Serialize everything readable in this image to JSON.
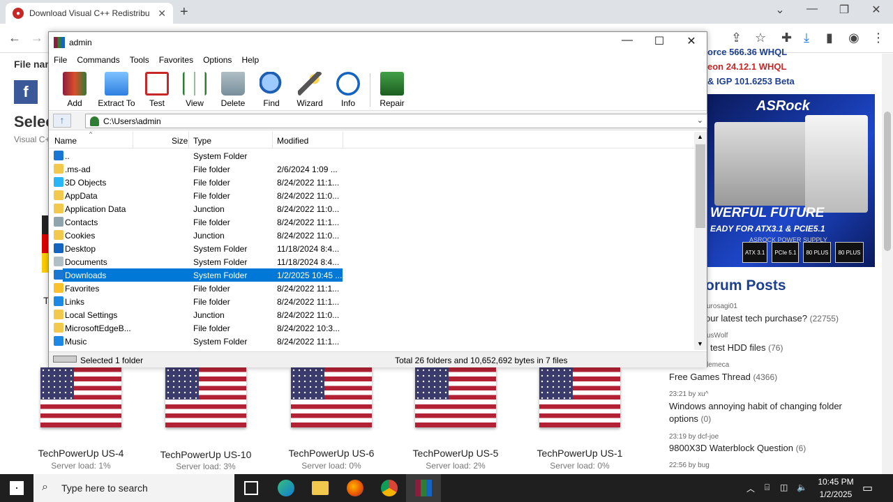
{
  "browser": {
    "tab_title": "Download Visual C++ Redistribu",
    "tab_close": "✕",
    "new_tab": "+"
  },
  "web": {
    "file_name_label": "File nam",
    "select_heading": "Selec",
    "sub_label": "Visual C+",
    "t_letter": "T",
    "driver_lines": [
      "orce 566.36 WHQL",
      "eon 24.12.1 WHQL",
      "& IGP 101.6253 Beta"
    ],
    "ad": {
      "brand": "ASRock",
      "line1": "WERFUL FUTURE",
      "line2": "EADY FOR ATX3.1 & PCIE5.1",
      "line3": "ASROCK POWER SUPPLY",
      "badges": [
        "ATX 3.1",
        "PCIe 5.1",
        "80 PLUS",
        "80 PLUS"
      ]
    },
    "forum_title": "orum Posts",
    "posts": [
      {
        "meta": "urosagi01",
        "title": "our latest tech purchase?",
        "count": "(22755)"
      },
      {
        "meta": "usWolf",
        "title": "test HDD files",
        "count": "(76)"
      },
      {
        "meta": "lemeca",
        "title": "Free Games Thread",
        "count": "(4366)"
      },
      {
        "meta": "23:21  by  xu^",
        "title": "Windows annoying habit of changing folder",
        "title2": "options",
        "count": "(0)"
      },
      {
        "meta": "23:19  by  dcf-joe",
        "title": "9800X3D Waterblock Question",
        "count": "(6)"
      },
      {
        "meta": "22:56  by  bug",
        "title": "",
        "count": ""
      }
    ],
    "servers": [
      {
        "name": "TechPowerUp US-4",
        "load": "Server load: 1%"
      },
      {
        "name": "TechPowerUp US-10",
        "load": "Server load: 3%"
      },
      {
        "name": "TechPowerUp US-6",
        "load": "Server load: 0%"
      },
      {
        "name": "TechPowerUp US-5",
        "load": "Server load: 2%"
      },
      {
        "name": "TechPowerUp US-1",
        "load": "Server load: 0%"
      }
    ]
  },
  "rar": {
    "title": "admin",
    "menu": [
      "File",
      "Commands",
      "Tools",
      "Favorites",
      "Options",
      "Help"
    ],
    "tools": [
      {
        "label": "Add",
        "color": "#b23a48"
      },
      {
        "label": "Extract To",
        "color": "#3b82d6"
      },
      {
        "label": "Test",
        "color": "#c62828"
      },
      {
        "label": "View",
        "color": "#2e7d32"
      },
      {
        "label": "Delete",
        "color": "#7a8899"
      },
      {
        "label": "Find",
        "color": "#1e5fb4"
      },
      {
        "label": "Wizard",
        "color": "#9c6ad4"
      },
      {
        "label": "Info",
        "color": "#1565c0"
      },
      {
        "label": "Repair",
        "color": "#2e9a3d"
      }
    ],
    "path": "C:\\Users\\admin",
    "columns": {
      "name": "Name",
      "size": "Size",
      "type": "Type",
      "modified": "Modified"
    },
    "files": [
      {
        "name": "..",
        "type": "System Folder",
        "modified": "",
        "color": "#1976d2"
      },
      {
        "name": ".ms-ad",
        "type": "File folder",
        "modified": "2/6/2024 1:09 ...",
        "color": "#f2c94c"
      },
      {
        "name": "3D Objects",
        "type": "File folder",
        "modified": "8/24/2022 11:1...",
        "color": "#29b6f6"
      },
      {
        "name": "AppData",
        "type": "File folder",
        "modified": "8/24/2022 11:0...",
        "color": "#f2c94c"
      },
      {
        "name": "Application Data",
        "type": "Junction",
        "modified": "8/24/2022 11:0...",
        "color": "#f2c94c"
      },
      {
        "name": "Contacts",
        "type": "File folder",
        "modified": "8/24/2022 11:1...",
        "color": "#90a4ae"
      },
      {
        "name": "Cookies",
        "type": "Junction",
        "modified": "8/24/2022 11:0...",
        "color": "#f2c94c"
      },
      {
        "name": "Desktop",
        "type": "System Folder",
        "modified": "11/18/2024 8:4...",
        "color": "#1565c0"
      },
      {
        "name": "Documents",
        "type": "System Folder",
        "modified": "11/18/2024 8:4...",
        "color": "#b0bec5"
      },
      {
        "name": "Downloads",
        "type": "System Folder",
        "modified": "1/2/2025 10:45 ...",
        "color": "#1976d2"
      },
      {
        "name": "Favorites",
        "type": "File folder",
        "modified": "8/24/2022 11:1...",
        "color": "#fbc02d"
      },
      {
        "name": "Links",
        "type": "File folder",
        "modified": "8/24/2022 11:1...",
        "color": "#1e88e5"
      },
      {
        "name": "Local Settings",
        "type": "Junction",
        "modified": "8/24/2022 11:0...",
        "color": "#f2c94c"
      },
      {
        "name": "MicrosoftEdgeB...",
        "type": "File folder",
        "modified": "8/24/2022 10:3...",
        "color": "#f2c94c"
      },
      {
        "name": "Music",
        "type": "System Folder",
        "modified": "8/24/2022 11:1...",
        "color": "#1e88e5"
      }
    ],
    "selected_index": 9,
    "status_left": "Selected 1 folder",
    "status_right": "Total 26 folders and 10,652,692 bytes in 7 files"
  },
  "taskbar": {
    "search_placeholder": "Type here to search",
    "time": "10:45 PM",
    "date": "1/2/2025"
  }
}
